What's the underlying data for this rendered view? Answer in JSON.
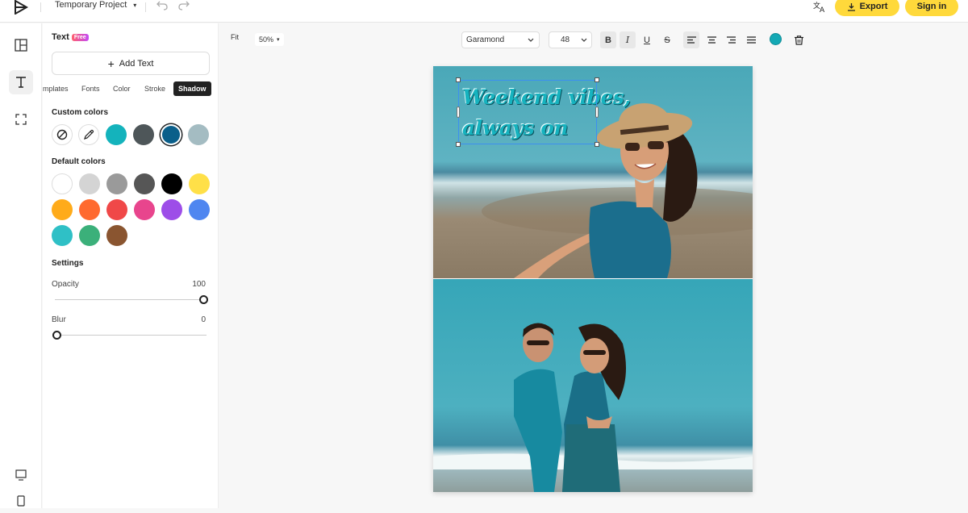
{
  "header": {
    "project_name": "Temporary Project",
    "export_label": "Export",
    "signin_label": "Sign in"
  },
  "panel": {
    "title": "Text",
    "badge": "Free",
    "add_text_label": "Add Text",
    "tabs": [
      "mplates",
      "Fonts",
      "Color",
      "Stroke",
      "Shadow"
    ],
    "active_tab": "Shadow",
    "custom_colors_label": "Custom colors",
    "custom_colors": [
      "#14b3bc",
      "#4e5659",
      "#0a5f8a",
      "#a4bcc2"
    ],
    "selected_custom_color": "#0a5f8a",
    "default_colors_label": "Default colors",
    "default_colors": [
      "#ffffff",
      "#d4d4d4",
      "#9a9a9a",
      "#565656",
      "#000000",
      "#ffe048",
      "#ffab1a",
      "#ff6a2f",
      "#f04848",
      "#e8458d",
      "#9d4de8",
      "#4f86f0",
      "#2fc0c6",
      "#3bb07a",
      "#8a5530"
    ],
    "settings_label": "Settings",
    "opacity_label": "Opacity",
    "opacity_value": "100",
    "blur_label": "Blur",
    "blur_value": "0"
  },
  "toolbar": {
    "fit_label": "Fit",
    "zoom_label": "50%",
    "font_name": "Garamond",
    "font_size": "48",
    "bold": "B",
    "italic": "I",
    "underline": "U",
    "strike": "S",
    "text_color": "#14a9b5"
  },
  "canvas": {
    "text_line1": "Weekend vibes,",
    "text_line2": "always on"
  }
}
